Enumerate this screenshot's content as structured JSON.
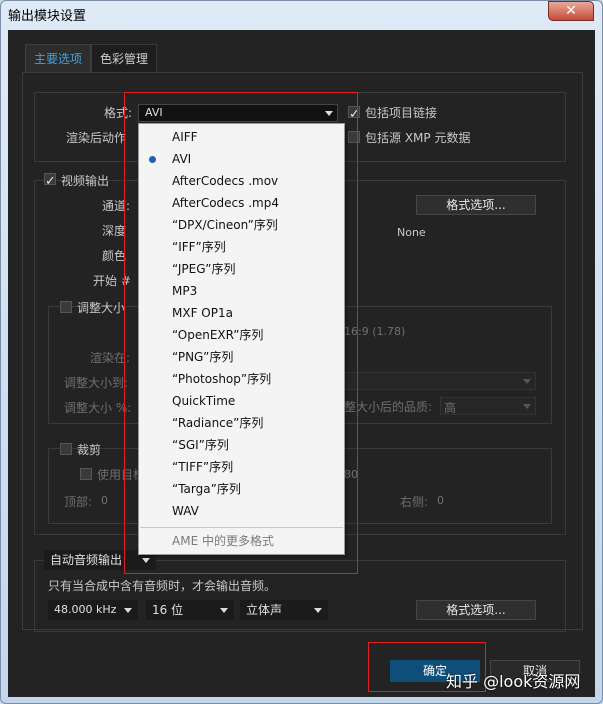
{
  "window": {
    "title": "输出模块设置",
    "close_glyph": "✕"
  },
  "tabs": [
    {
      "label": "主要选项",
      "active": true
    },
    {
      "label": "色彩管理",
      "active": false
    }
  ],
  "format": {
    "label": "格式:",
    "value": "AVI"
  },
  "post_render": {
    "label": "渲染后动作"
  },
  "include_project_link": {
    "label": "包括项目链接",
    "checked": true
  },
  "include_xmp": {
    "label": "包括源 XMP 元数据",
    "checked": false
  },
  "video_output": {
    "label": "视频输出",
    "checked": true,
    "channels_label": "通道:",
    "depth_label": "深度",
    "color_label": "颜色",
    "start_label": "开始 #",
    "format_options": "格式选项...",
    "codec_value": "None"
  },
  "resize": {
    "label": "调整大小",
    "aspect": "16:9 (1.78)",
    "render_at": "渲染在:",
    "resize_to": "调整大小到:",
    "resize_pct": "调整大小 %:",
    "quality_label": "整大小后的品质:",
    "quality_value": "高"
  },
  "crop": {
    "label": "裁剪",
    "use_target": "使用目标",
    "value_80": "80",
    "top": "顶部:",
    "top_val": "0",
    "right": "右侧:",
    "right_val": "0"
  },
  "audio": {
    "toggle": "自动音频输出",
    "note": "只有当合成中含有音频时，才会输出音频。",
    "sample_rate": "48.000 kHz",
    "bit_depth": "16 位",
    "channels": "立体声",
    "format_options": "格式选项..."
  },
  "format_menu": {
    "items": [
      "AIFF",
      "AVI",
      "AfterCodecs .mov",
      "AfterCodecs .mp4",
      "“DPX/Cineon”序列",
      "“IFF”序列",
      "“JPEG”序列",
      "MP3",
      "MXF OP1a",
      "“OpenEXR”序列",
      "“PNG”序列",
      "“Photoshop”序列",
      "QuickTime",
      "“Radiance”序列",
      "“SGI”序列",
      "“TIFF”序列",
      "“Targa”序列",
      "WAV"
    ],
    "selected": "AVI",
    "more": "AME 中的更多格式"
  },
  "buttons": {
    "ok": "确定",
    "cancel": "取消"
  },
  "watermark": "知乎 @look资源网",
  "colors": {
    "accent": "#43a0e0",
    "highlight_border": "#e02020",
    "ok_button": "#0e4f7a"
  }
}
